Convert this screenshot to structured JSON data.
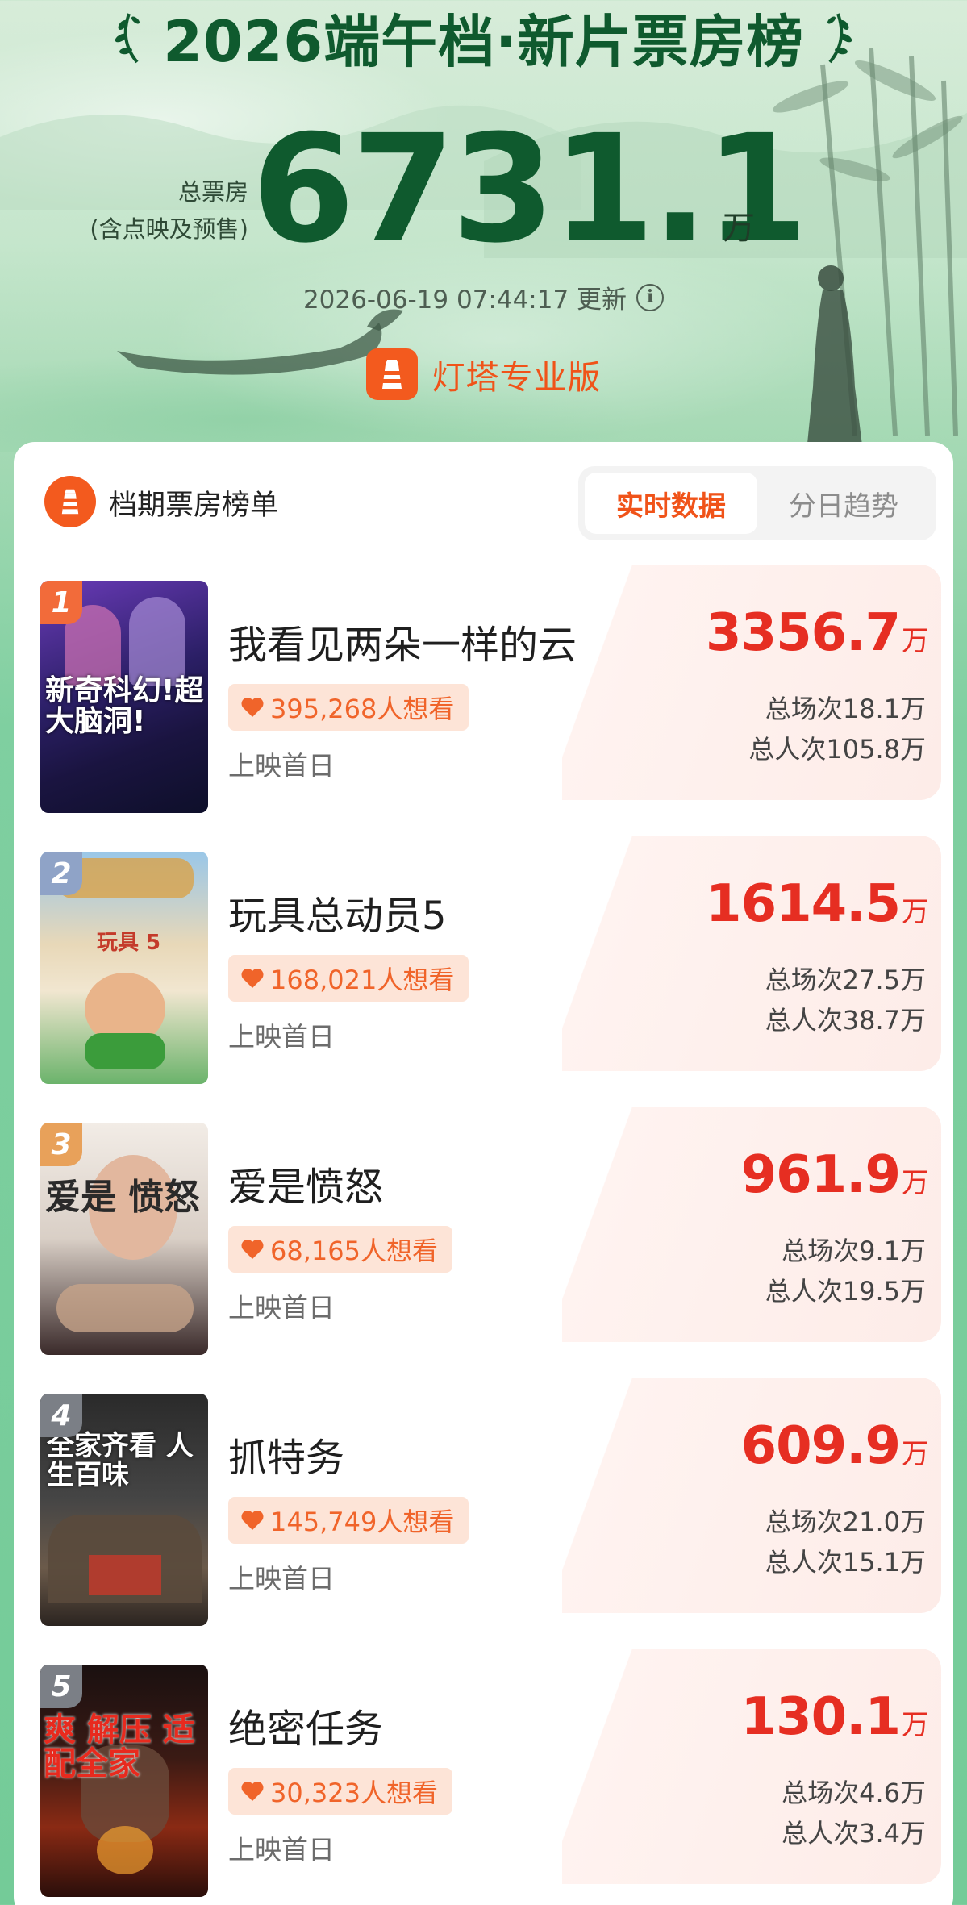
{
  "header": {
    "title": "2026端午档·新片票房榜",
    "total_label_line1": "总票房",
    "total_label_line2": "(含点映及预售)",
    "total_value": "6731.1",
    "total_unit": "万",
    "updated": "2026-06-19 07:44:17 更新",
    "info_icon": "info-icon",
    "brand": "灯塔专业版"
  },
  "card": {
    "title": "档期票房榜单",
    "tabs": [
      {
        "label": "实时数据",
        "active": true
      },
      {
        "label": "分日趋势",
        "active": false
      }
    ]
  },
  "movies": [
    {
      "rank": "1",
      "title": "我看见两朵一样的云",
      "want": "395,268人想看",
      "release": "上映首日",
      "gross": "3356.7",
      "unit": "万",
      "shows": "总场次18.1万",
      "admissions": "总人次105.8万",
      "poster_text": "新奇科幻!超大脑洞!"
    },
    {
      "rank": "2",
      "title": "玩具总动员5",
      "want": "168,021人想看",
      "release": "上映首日",
      "gross": "1614.5",
      "unit": "万",
      "shows": "总场次27.5万",
      "admissions": "总人次38.7万",
      "poster_text": "玩具 5"
    },
    {
      "rank": "3",
      "title": "爱是愤怒",
      "want": "68,165人想看",
      "release": "上映首日",
      "gross": "961.9",
      "unit": "万",
      "shows": "总场次9.1万",
      "admissions": "总人次19.5万",
      "poster_text": "爱是 愤怒"
    },
    {
      "rank": "4",
      "title": "抓特务",
      "want": "145,749人想看",
      "release": "上映首日",
      "gross": "609.9",
      "unit": "万",
      "shows": "总场次21.0万",
      "admissions": "总人次15.1万",
      "poster_text": "全家齐看 人生百味"
    },
    {
      "rank": "5",
      "title": "绝密任务",
      "want": "30,323人想看",
      "release": "上映首日",
      "gross": "130.1",
      "unit": "万",
      "shows": "总场次4.6万",
      "admissions": "总人次3.4万",
      "poster_text": "爽 解压 适配全家"
    }
  ],
  "colors": {
    "title_green": "#0f5a2e",
    "accent_orange": "#f05319",
    "gross_red": "#e62e22",
    "rank_1": "#f26b3a",
    "rank_2": "#8fa3c7",
    "rank_3": "#e8a15a",
    "rank_4": "#7b7f86",
    "rank_5": "#7b7f86"
  }
}
